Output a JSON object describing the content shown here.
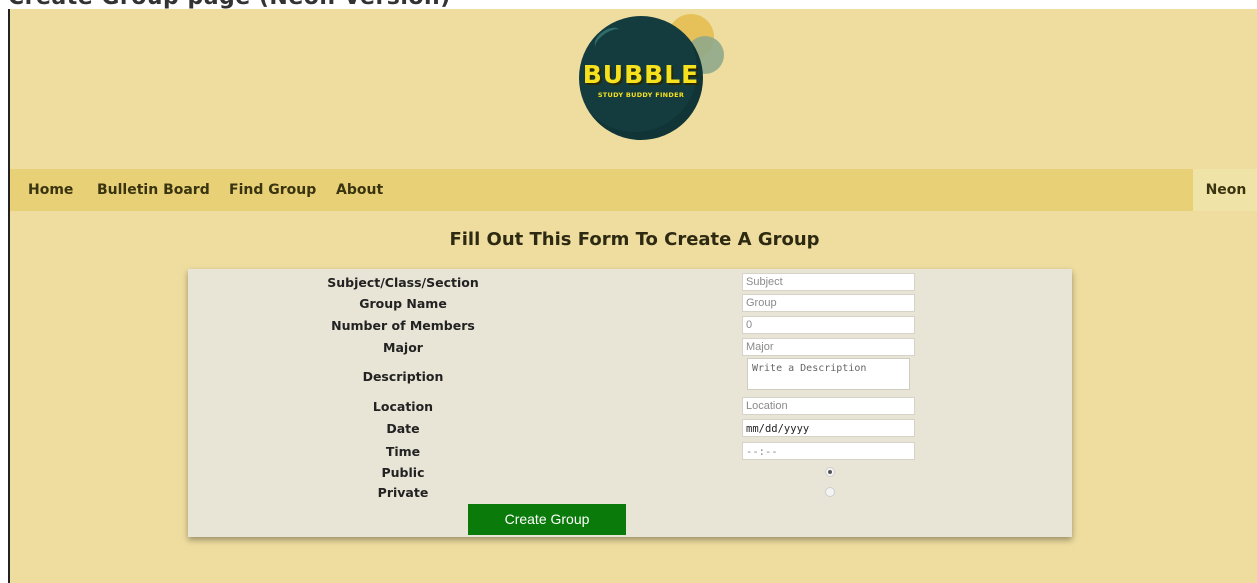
{
  "page": {
    "cut_title": "Create Group page (Neon Version)"
  },
  "logo": {
    "title": "BUBBLE",
    "subtitle": "STUDY BUDDY FINDER"
  },
  "nav": {
    "items": [
      {
        "label": "Home"
      },
      {
        "label": "Bulletin Board"
      },
      {
        "label": "Find Group"
      },
      {
        "label": "About"
      }
    ],
    "user": "Neon"
  },
  "form": {
    "title": "Fill Out This Form To Create A Group",
    "fields": {
      "subject": {
        "label": "Subject/Class/Section",
        "placeholder": "Subject"
      },
      "group_name": {
        "label": "Group Name",
        "placeholder": "Group"
      },
      "members": {
        "label": "Number of Members",
        "placeholder": "0"
      },
      "major": {
        "label": "Major",
        "placeholder": "Major"
      },
      "description": {
        "label": "Description",
        "placeholder": "Write a Description"
      },
      "location": {
        "label": "Location",
        "placeholder": "Location"
      },
      "date": {
        "label": "Date",
        "value": "mm/dd/yyyy"
      },
      "time": {
        "label": "Time",
        "value": "--:--"
      },
      "public": {
        "label": "Public",
        "checked": true
      },
      "private": {
        "label": "Private",
        "checked": false
      }
    },
    "submit_label": "Create Group"
  },
  "colors": {
    "background": "#eedd9f",
    "navbar": "#e7d076",
    "panel": "#e8e5d6",
    "button": "#0a7a0a",
    "logo_circle": "#143c3e",
    "logo_text": "#f5e11d"
  }
}
